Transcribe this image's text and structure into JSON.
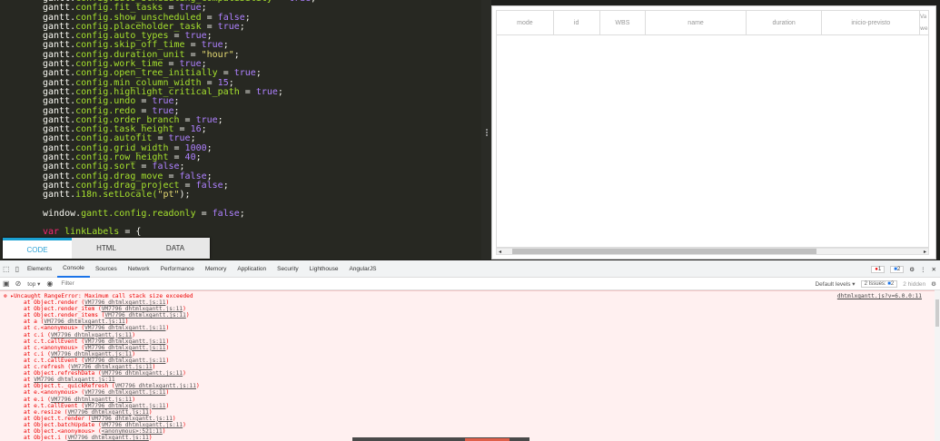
{
  "editor": {
    "lines": [
      [
        [
          "gantt.",
          "g"
        ],
        [
          "config.auto_scheduling_compatibility",
          "p"
        ],
        [
          " = ",
          "g"
        ],
        [
          "true",
          "v"
        ],
        [
          ";",
          "g"
        ]
      ],
      [
        [
          "gantt.",
          "g"
        ],
        [
          "config.fit_tasks",
          "p"
        ],
        [
          " = ",
          "g"
        ],
        [
          "true",
          "v"
        ],
        [
          ";",
          "g"
        ]
      ],
      [
        [
          "gantt.",
          "g"
        ],
        [
          "config.show_unscheduled",
          "p"
        ],
        [
          " = ",
          "g"
        ],
        [
          "false",
          "v"
        ],
        [
          ";",
          "g"
        ]
      ],
      [
        [
          "gantt.",
          "g"
        ],
        [
          "config.placeholder_task",
          "p"
        ],
        [
          " = ",
          "g"
        ],
        [
          "true",
          "v"
        ],
        [
          ";",
          "g"
        ]
      ],
      [
        [
          "gantt.",
          "g"
        ],
        [
          "config.auto_types",
          "p"
        ],
        [
          " = ",
          "g"
        ],
        [
          "true",
          "v"
        ],
        [
          ";",
          "g"
        ]
      ],
      [
        [
          "gantt.",
          "g"
        ],
        [
          "config.skip_off_time",
          "p"
        ],
        [
          " = ",
          "g"
        ],
        [
          "true",
          "v"
        ],
        [
          ";",
          "g"
        ]
      ],
      [
        [
          "gantt.",
          "g"
        ],
        [
          "config.duration_unit",
          "p"
        ],
        [
          " = ",
          "g"
        ],
        [
          "\"hour\"",
          "s"
        ],
        [
          ";",
          "g"
        ]
      ],
      [
        [
          "gantt.",
          "g"
        ],
        [
          "config.work_time",
          "p"
        ],
        [
          " = ",
          "g"
        ],
        [
          "true",
          "v"
        ],
        [
          ";",
          "g"
        ]
      ],
      [
        [
          "gantt.",
          "g"
        ],
        [
          "config.open_tree_initially",
          "p"
        ],
        [
          " = ",
          "g"
        ],
        [
          "true",
          "v"
        ],
        [
          ";",
          "g"
        ]
      ],
      [
        [
          "gantt.",
          "g"
        ],
        [
          "config.min_column_width",
          "p"
        ],
        [
          " = ",
          "g"
        ],
        [
          "15",
          "v"
        ],
        [
          ";",
          "g"
        ]
      ],
      [
        [
          "gantt.",
          "g"
        ],
        [
          "config.highlight_critical_path",
          "p"
        ],
        [
          " = ",
          "g"
        ],
        [
          "true",
          "v"
        ],
        [
          ";",
          "g"
        ]
      ],
      [
        [
          "gantt.",
          "g"
        ],
        [
          "config.undo",
          "p"
        ],
        [
          " = ",
          "g"
        ],
        [
          "true",
          "v"
        ],
        [
          ";",
          "g"
        ]
      ],
      [
        [
          "gantt.",
          "g"
        ],
        [
          "config.redo",
          "p"
        ],
        [
          " = ",
          "g"
        ],
        [
          "true",
          "v"
        ],
        [
          ";",
          "g"
        ]
      ],
      [
        [
          "gantt.",
          "g"
        ],
        [
          "config.order_branch",
          "p"
        ],
        [
          " = ",
          "g"
        ],
        [
          "true",
          "v"
        ],
        [
          ";",
          "g"
        ]
      ],
      [
        [
          "gantt.",
          "g"
        ],
        [
          "config.task_height",
          "p"
        ],
        [
          " = ",
          "g"
        ],
        [
          "16",
          "v"
        ],
        [
          ";",
          "g"
        ]
      ],
      [
        [
          "gantt.",
          "g"
        ],
        [
          "config.autofit",
          "p"
        ],
        [
          " = ",
          "g"
        ],
        [
          "true",
          "v"
        ],
        [
          ";",
          "g"
        ]
      ],
      [
        [
          "gantt.",
          "g"
        ],
        [
          "config.grid_width",
          "p"
        ],
        [
          " = ",
          "g"
        ],
        [
          "1000",
          "v"
        ],
        [
          ";",
          "g"
        ]
      ],
      [
        [
          "gantt.",
          "g"
        ],
        [
          "config.row_height",
          "p"
        ],
        [
          " = ",
          "g"
        ],
        [
          "40",
          "v"
        ],
        [
          ";",
          "g"
        ]
      ],
      [
        [
          "gantt.",
          "g"
        ],
        [
          "config.sort",
          "p"
        ],
        [
          " = ",
          "g"
        ],
        [
          "false",
          "v"
        ],
        [
          ";",
          "g"
        ]
      ],
      [
        [
          "gantt.",
          "g"
        ],
        [
          "config.drag_move",
          "p"
        ],
        [
          " = ",
          "g"
        ],
        [
          "false",
          "v"
        ],
        [
          ";",
          "g"
        ]
      ],
      [
        [
          "gantt.",
          "g"
        ],
        [
          "config.drag_project",
          "p"
        ],
        [
          " = ",
          "g"
        ],
        [
          "false",
          "v"
        ],
        [
          ";",
          "g"
        ]
      ],
      [
        [
          "gantt.",
          "g"
        ],
        [
          "i18n.setLocale(",
          "p"
        ],
        [
          "\"pt\"",
          "s"
        ],
        [
          ");",
          "g"
        ]
      ],
      [],
      [
        [
          "window.",
          "g"
        ],
        [
          "gantt.config.readonly",
          "p"
        ],
        [
          " = ",
          "g"
        ],
        [
          "false",
          "v"
        ],
        [
          ";",
          "g"
        ]
      ],
      [],
      [
        [
          "var ",
          "k"
        ],
        [
          "linkLabels",
          "p"
        ],
        [
          " = {",
          "g"
        ]
      ]
    ],
    "tabs": [
      "CODE",
      "HTML",
      "DATA"
    ]
  },
  "gantt": {
    "columns": [
      "mode",
      "id",
      "WBS",
      "name",
      "duration",
      "inicio-previsto"
    ],
    "partial_column": [
      "Va",
      "we"
    ]
  },
  "devtools": {
    "tabs": [
      "Elements",
      "Console",
      "Sources",
      "Network",
      "Performance",
      "Memory",
      "Application",
      "Security",
      "Lighthouse",
      "AngularJS"
    ],
    "active_tab": "Console",
    "error_count": "1",
    "issue_count": "2",
    "context": "top ▾",
    "filter_placeholder": "Filter",
    "levels": "Default levels ▾",
    "issues": "2 Issues:",
    "issues_num": "2",
    "hidden": "2 hidden",
    "error_message": "▸Uncaught RangeError: Maximum call stack size exceeded",
    "error_source": "dhtmlxgantt.js?v=6.0.0:11",
    "stack": [
      [
        "at Object.render (",
        "VM7796 dhtmlxgantt.js:11",
        ")"
      ],
      [
        "at Object.render_item (",
        "VM7796 dhtmlxgantt.js:11",
        ")"
      ],
      [
        "at Object.render_items (",
        "VM7796 dhtmlxgantt.js:11",
        ")"
      ],
      [
        "at a (",
        "VM7796 dhtmlxgantt.js:11",
        ")"
      ],
      [
        "at c.<anonymous> (",
        "VM7796 dhtmlxgantt.js:11",
        ")"
      ],
      [
        "at c.i (",
        "VM7796 dhtmlxgantt.js:11",
        ")"
      ],
      [
        "at c.t.callEvent (",
        "VM7796 dhtmlxgantt.js:11",
        ")"
      ],
      [
        "at c.<anonymous> (",
        "VM7796 dhtmlxgantt.js:11",
        ")"
      ],
      [
        "at c.i (",
        "VM7796 dhtmlxgantt.js:11",
        ")"
      ],
      [
        "at c.t.callEvent (",
        "VM7796 dhtmlxgantt.js:11",
        ")"
      ],
      [
        "at c.refresh (",
        "VM7796 dhtmlxgantt.js:11",
        ")"
      ],
      [
        "at Object.refreshData (",
        "VM7796 dhtmlxgantt.js:11",
        ")"
      ],
      [
        "at ",
        "VM7796 dhtmlxgantt.js:11",
        ""
      ],
      [
        "at Object.t._quickRefresh (",
        "VM7796 dhtmlxgantt.js:11",
        ")"
      ],
      [
        "at e.<anonymous> (",
        "VM7796 dhtmlxgantt.js:11",
        ")"
      ],
      [
        "at e.i (",
        "VM7796 dhtmlxgantt.js:11",
        ")"
      ],
      [
        "at e.t.callEvent (",
        "VM7796 dhtmlxgantt.js:11",
        ")"
      ],
      [
        "at e.resize (",
        "VM7796 dhtmlxgantt.js:11",
        ")"
      ],
      [
        "at Object.t.render (",
        "VM7796 dhtmlxgantt.js:11",
        ")"
      ],
      [
        "at Object.batchUpdate (",
        "VM7796 dhtmlxgantt.js:11",
        ")"
      ],
      [
        "at Object.<anonymous> (",
        "<anonymous>:521:11",
        ")"
      ],
      [
        "at Object.i (",
        "VM7796 dhtmlxgantt.js:11",
        ")"
      ]
    ]
  }
}
